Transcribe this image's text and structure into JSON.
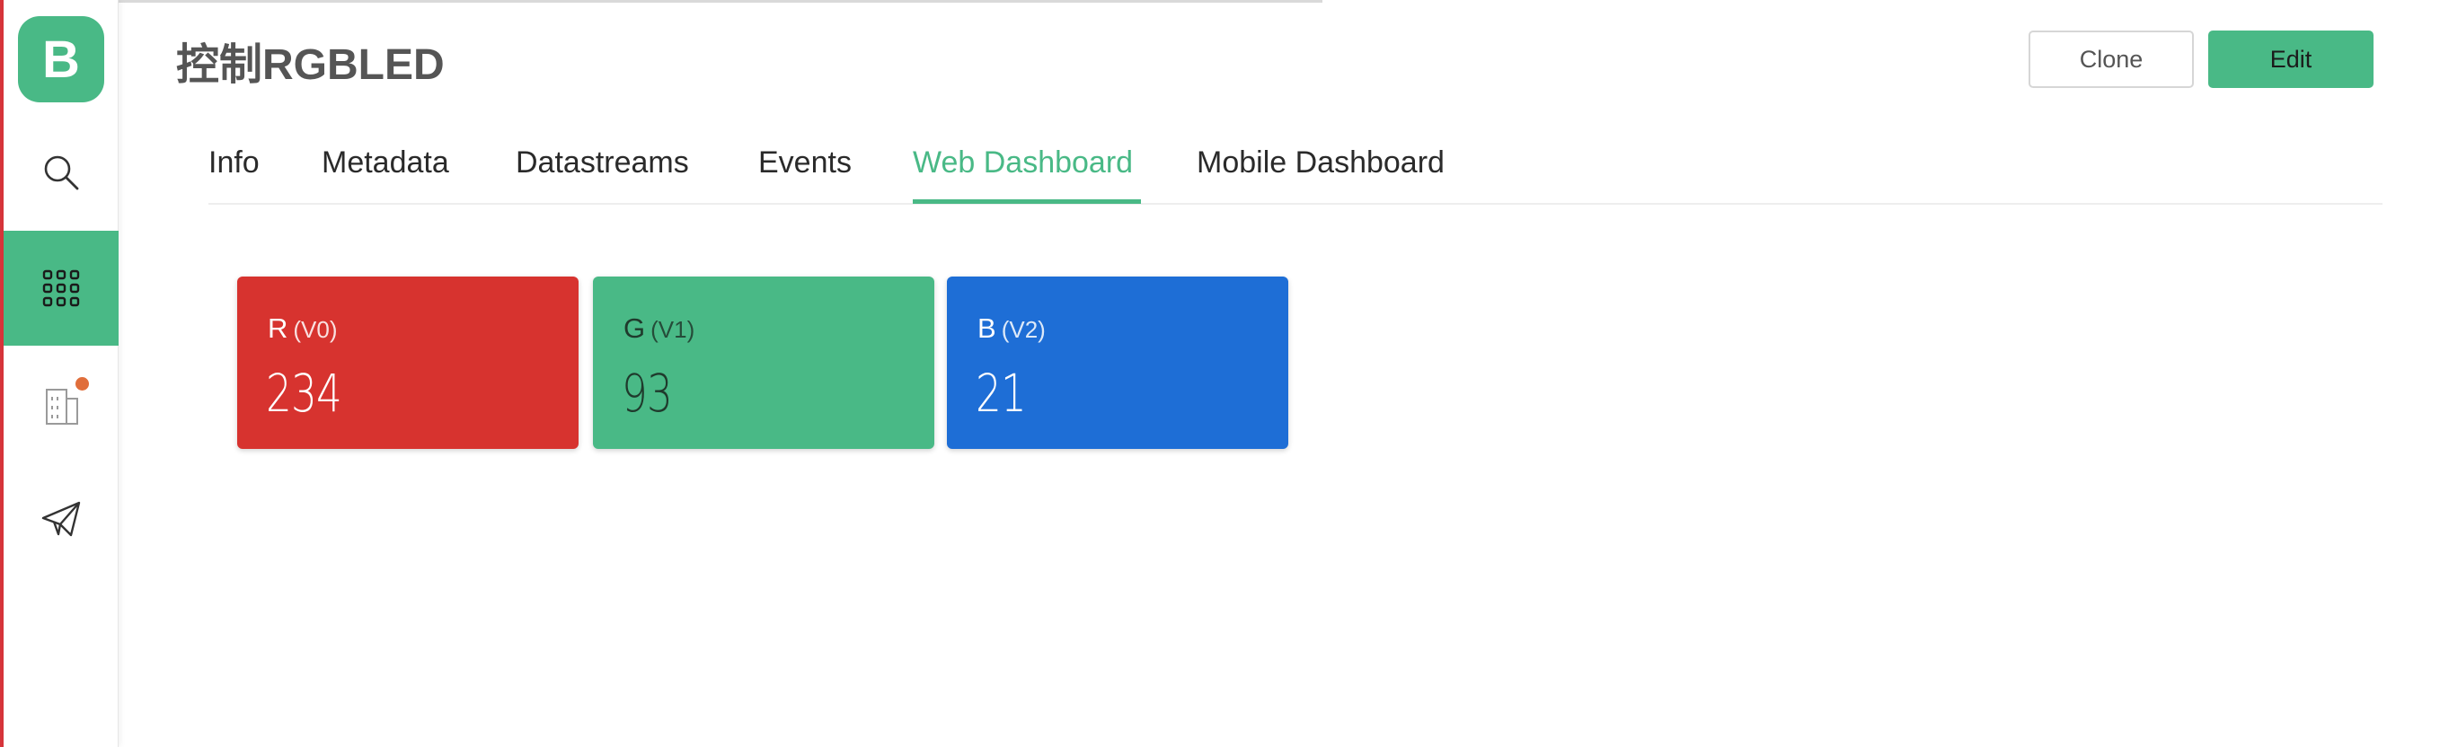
{
  "app": {
    "logo_letter": "B",
    "page_title": "控制RGBLED"
  },
  "sidebar": {
    "items": [
      {
        "icon": "search-icon"
      },
      {
        "icon": "grid-icon",
        "active": true
      },
      {
        "icon": "organization-icon",
        "has_badge": true
      },
      {
        "icon": "send-icon"
      }
    ]
  },
  "header": {
    "clone_label": "Clone",
    "edit_label": "Edit"
  },
  "tabs": [
    {
      "label": "Info"
    },
    {
      "label": "Metadata"
    },
    {
      "label": "Datastreams"
    },
    {
      "label": "Events"
    },
    {
      "label": "Web Dashboard",
      "active": true
    },
    {
      "label": "Mobile Dashboard"
    }
  ],
  "widgets": [
    {
      "name": "R",
      "pin": "(V0)",
      "value": "234",
      "color": "#d7332f"
    },
    {
      "name": "G",
      "pin": "(V1)",
      "value": "93",
      "color": "#49b986"
    },
    {
      "name": "B",
      "pin": "(V2)",
      "value": "21",
      "color": "#1e6ed6"
    }
  ],
  "colors": {
    "accent": "#49b986",
    "badge": "#e06e3b"
  }
}
